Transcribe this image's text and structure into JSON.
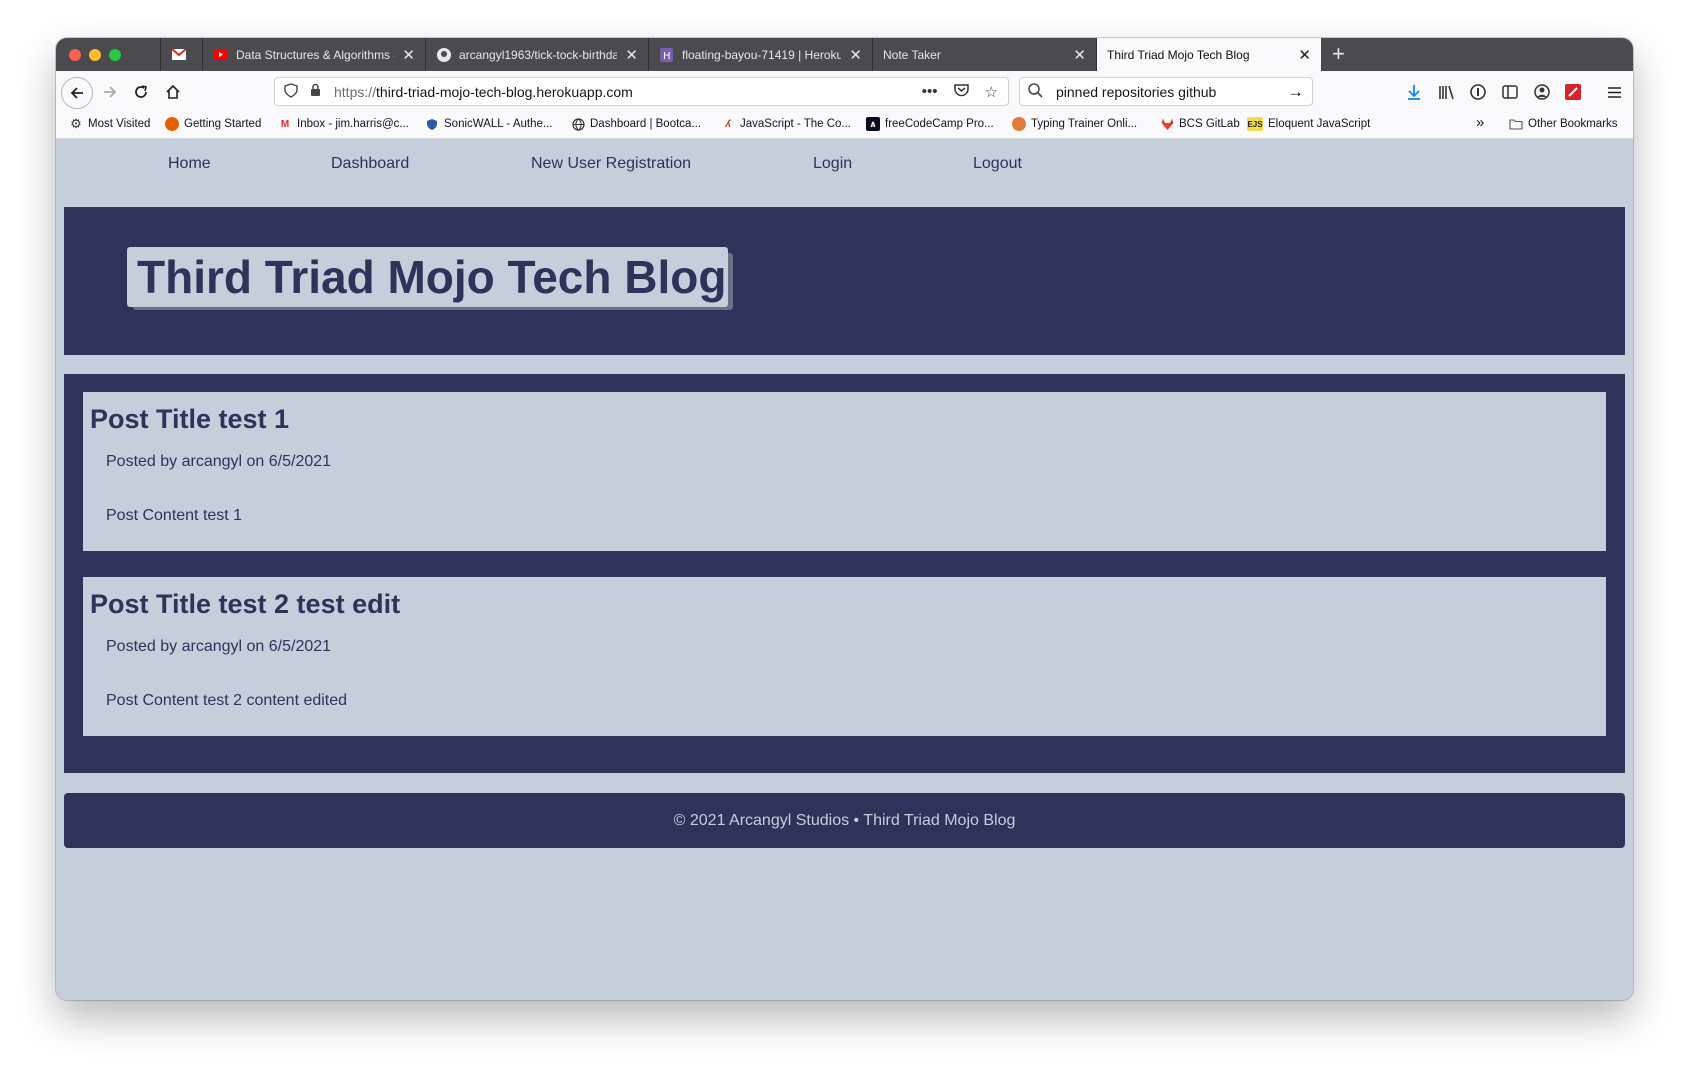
{
  "browser": {
    "tabs": [
      {
        "label": "",
        "favicon": "gmail-icon"
      },
      {
        "label": "Data Structures & Algorithms #",
        "favicon": "youtube-icon"
      },
      {
        "label": "arcangyl1963/tick-tock-birthda",
        "favicon": "github-icon"
      },
      {
        "label": "floating-bayou-71419 | Heroku",
        "favicon": "heroku-icon"
      },
      {
        "label": "Note Taker",
        "favicon": ""
      },
      {
        "label": "Third Triad Mojo Tech Blog",
        "favicon": ""
      }
    ],
    "url_protocol": "https://",
    "url_host": "third-triad-mojo-tech-blog.herokuapp.com",
    "search_value": "pinned repositories github",
    "bookmarks": [
      {
        "label": "Most Visited",
        "icon": "gear-icon"
      },
      {
        "label": "Getting Started",
        "icon": "firefox-icon"
      },
      {
        "label": "Inbox - jim.harris@c...",
        "icon": "gmail-icon"
      },
      {
        "label": "SonicWALL - Authe...",
        "icon": "shield-icon"
      },
      {
        "label": "Dashboard | Bootca...",
        "icon": "globe-icon"
      },
      {
        "label": "JavaScript - The Co...",
        "icon": "javascript-icon"
      },
      {
        "label": "freeCodeCamp Pro...",
        "icon": "freecodecamp-icon"
      },
      {
        "label": "Typing Trainer Onli...",
        "icon": "typing-icon"
      },
      {
        "label": "BCS GitLab",
        "icon": "gitlab-icon"
      },
      {
        "label": "Eloquent JavaScript",
        "icon": "ejs-icon"
      },
      {
        "label": "Other Bookmarks",
        "icon": "folder-icon"
      }
    ]
  },
  "site": {
    "nav": [
      "Home",
      "Dashboard",
      "New User Registration",
      "Login",
      "Logout"
    ],
    "title": "Third Triad Mojo Tech Blog",
    "posts": [
      {
        "title": "Post Title test 1",
        "meta": "Posted by arcangyl on 6/5/2021",
        "content": "Post Content test 1"
      },
      {
        "title": "Post Title test 2 test edit",
        "meta": "Posted by arcangyl on 6/5/2021",
        "content": "Post Content test 2 content edited"
      }
    ],
    "footer": "© 2021 Arcangyl Studios • Third Triad Mojo Blog"
  },
  "colors": {
    "primary": "#2d3359",
    "background": "#c5cfdc"
  }
}
